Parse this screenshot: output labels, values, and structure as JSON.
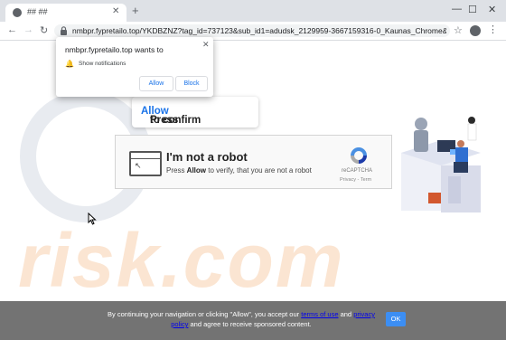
{
  "browser": {
    "tab_title": "## ##",
    "url": "nmbpr.fypretailo.top/YKDBZNZ?tag_id=737123&sub_id1=adudsk_2129959-3667159316-0_Kaunas_Chrome&sub_id2=12..."
  },
  "notification_popup": {
    "title": "nmbpr.fypretailo.top wants to",
    "message": "Show notifications",
    "allow_label": "Allow",
    "block_label": "Block"
  },
  "press_prompt": {
    "before": "Press ",
    "highlight": "Allow",
    "after": " to confirm"
  },
  "captcha": {
    "title": "I'm not a robot",
    "subtitle_before": "Press ",
    "subtitle_bold": "Allow",
    "subtitle_after": " to verify, that you are not a robot",
    "brand": "reCAPTCHA",
    "links": "Privacy - Term"
  },
  "watermark": {
    "text": "risk.com"
  },
  "banner": {
    "text_1": "By continuing your navigation or clicking \"Allow\", you accept our ",
    "terms_link": "terms of use",
    "text_2": " and ",
    "privacy_link": "privacy policy",
    "text_3": " and agree to receive sponsored content.",
    "ok_label": "OK"
  },
  "colors": {
    "allow_accent": "#1a73e8",
    "banner_bg": "#737373",
    "ok_button": "#3c8ef3"
  }
}
